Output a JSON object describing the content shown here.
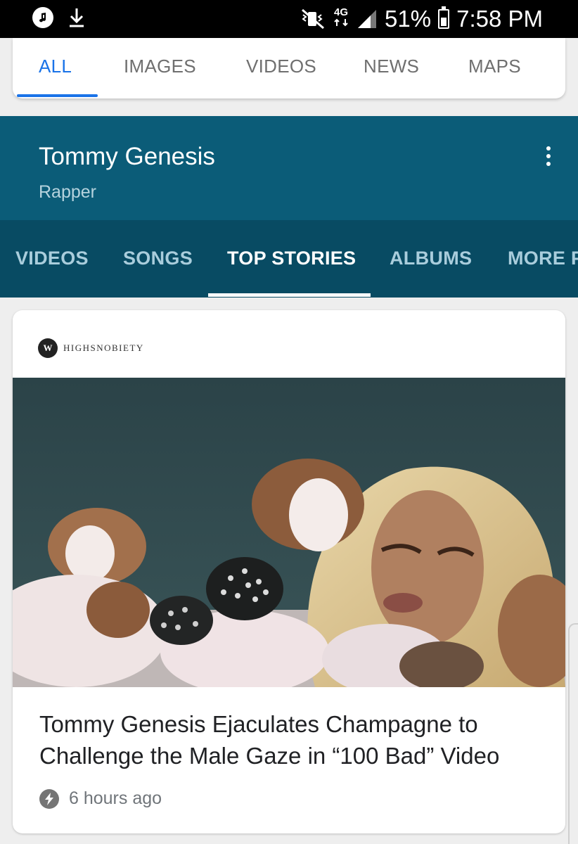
{
  "status_bar": {
    "notification_icons": [
      "music-icon",
      "download-icon"
    ],
    "network_label": "4G",
    "battery_percent": "51%",
    "time": "7:58 PM"
  },
  "search_tabs": [
    {
      "label": "ALL",
      "active": true
    },
    {
      "label": "IMAGES",
      "active": false
    },
    {
      "label": "VIDEOS",
      "active": false
    },
    {
      "label": "NEWS",
      "active": false
    },
    {
      "label": "MAPS",
      "active": false
    }
  ],
  "knowledge_panel": {
    "title": "Tommy Genesis",
    "subtitle": "Rapper",
    "menu_icon": "more-vert-icon",
    "tabs": [
      {
        "label": "VIDEOS",
        "active": false
      },
      {
        "label": "SONGS",
        "active": false
      },
      {
        "label": "TOP STORIES",
        "active": true
      },
      {
        "label": "ALBUMS",
        "active": false
      },
      {
        "label": "MORE P",
        "active": false
      }
    ]
  },
  "story": {
    "publisher": "HIGHSNOBIETY",
    "image_icon": "story-photo",
    "headline": "Tommy Genesis Ejaculates Champagne to Challenge the Male Gaze in “100 Bad” Video",
    "time_icon": "lightning-icon",
    "time": "6 hours ago"
  },
  "colors": {
    "accent_blue": "#1a73e8",
    "panel_teal": "#0b5c78",
    "panel_teal_dark": "#084b63"
  }
}
